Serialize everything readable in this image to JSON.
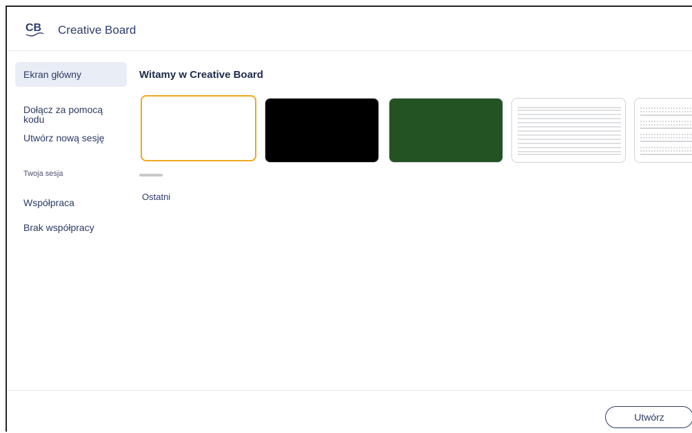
{
  "header": {
    "logo_text": "CB",
    "title": "Creative Board"
  },
  "sidebar": {
    "items": [
      {
        "label": "Ekran główny"
      },
      {
        "label": "Dołącz za pomocą\nkodu"
      },
      {
        "label": "Utwórz nową sesję"
      }
    ],
    "section_label": "Twoja sesja",
    "session_items": [
      {
        "label": "Współpraca"
      },
      {
        "label": "Brak współpracy"
      }
    ]
  },
  "main": {
    "welcome": "Witamy w Creative Board",
    "recent_label": "Ostatni",
    "templates": [
      {
        "name": "white-template",
        "background": "#ffffff",
        "selected": true
      },
      {
        "name": "black-template",
        "background": "#000000"
      },
      {
        "name": "green-template",
        "background": "#235223"
      },
      {
        "name": "lined-template",
        "background": "#ffffff"
      },
      {
        "name": "dotted-lined-template",
        "background": "#ffffff"
      }
    ]
  },
  "footer": {
    "create_label": "Utwórz"
  },
  "colors": {
    "accent": "#f0a81e",
    "text": "#2c3a66",
    "active_bg": "#e9edf5"
  }
}
